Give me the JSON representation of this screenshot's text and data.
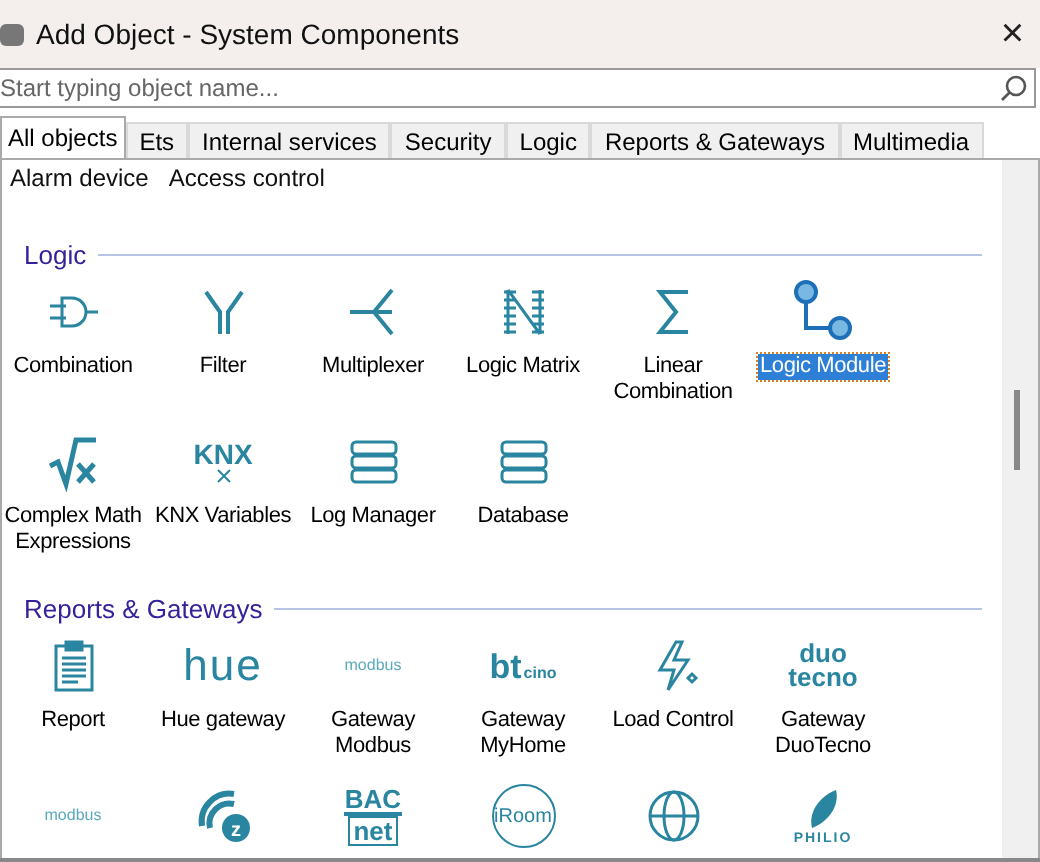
{
  "window": {
    "title": "Add Object - System Components",
    "close": "×"
  },
  "search": {
    "placeholder": "Start typing object name..."
  },
  "tabs": [
    {
      "label": "All objects",
      "selected": true
    },
    {
      "label": "Ets",
      "selected": false
    },
    {
      "label": "Internal services",
      "selected": false
    },
    {
      "label": "Security",
      "selected": false
    },
    {
      "label": "Logic",
      "selected": false
    },
    {
      "label": "Reports & Gateways",
      "selected": false
    },
    {
      "label": "Multimedia",
      "selected": false
    }
  ],
  "previous_items": [
    "Alarm device",
    "Access control"
  ],
  "sections": [
    {
      "title": "Logic",
      "items": [
        {
          "label": "Combination",
          "kind": "gate",
          "selected": false
        },
        {
          "label": "Filter",
          "kind": "filter",
          "selected": false
        },
        {
          "label": "Multiplexer",
          "kind": "mux",
          "selected": false
        },
        {
          "label": "Logic Matrix",
          "kind": "matrix",
          "selected": false
        },
        {
          "label": "Linear Combination",
          "kind": "sigma",
          "selected": false
        },
        {
          "label": "Logic Module",
          "kind": "module",
          "selected": true
        },
        {
          "label": "Complex Math Expressions",
          "kind": "sqrt",
          "selected": false
        },
        {
          "label": "KNX Variables",
          "kind": "knx",
          "logo": "KNX",
          "selected": false
        },
        {
          "label": "Log Manager",
          "kind": "db",
          "selected": false
        },
        {
          "label": "Database",
          "kind": "db",
          "selected": false
        }
      ]
    },
    {
      "title": "Reports & Gateways",
      "items": [
        {
          "label": "Report",
          "kind": "report",
          "selected": false
        },
        {
          "label": "Hue gateway",
          "kind": "hue",
          "logo": "hue",
          "selected": false
        },
        {
          "label": "Gateway Modbus",
          "kind": "modbus",
          "logo": "modbus",
          "selected": false
        },
        {
          "label": "Gateway MyHome",
          "kind": "bt",
          "logo": "bt",
          "logo_small": "cino",
          "selected": false
        },
        {
          "label": "Load Control",
          "kind": "bolt",
          "selected": false
        },
        {
          "label": "Gateway DuoTecno",
          "kind": "duotecno",
          "logo": "duo",
          "logo_small": "tecno",
          "selected": false
        },
        {
          "kind": "modbus",
          "logo": "modbus"
        },
        {
          "kind": "zwave",
          "logo": "z"
        },
        {
          "kind": "bacnet",
          "logo": "BAC",
          "logo_small": "net"
        },
        {
          "kind": "iroom",
          "logo": "iRoom"
        },
        {
          "kind": "globe"
        },
        {
          "kind": "philio",
          "logo": "PHILIO"
        }
      ]
    }
  ]
}
